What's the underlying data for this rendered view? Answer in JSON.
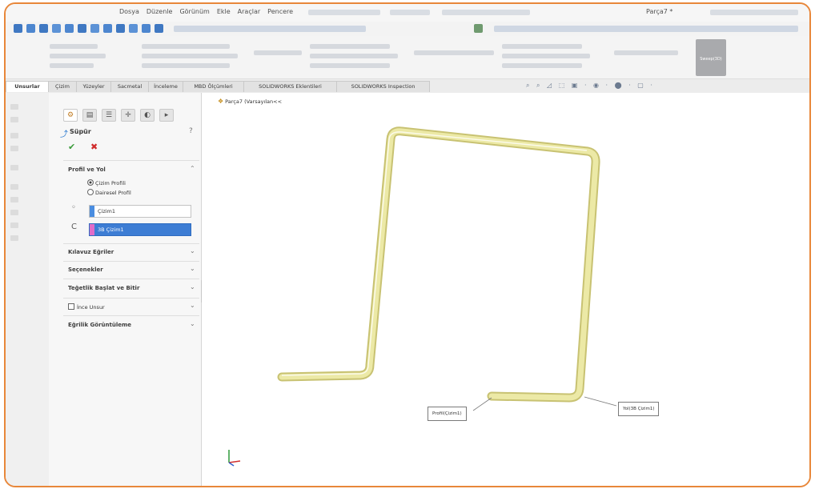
{
  "menubar": {
    "items": [
      "Dosya",
      "Düzenle",
      "Görünüm",
      "Ekle",
      "Araçlar",
      "Pencere"
    ],
    "document_title": "Parça7 *"
  },
  "tabs": [
    "Unsurlar",
    "Çizim",
    "Yüzeyler",
    "Sacmetal",
    "İnceleme",
    "MBD Ölçümleri",
    "SOLIDWORKS Eklentileri",
    "SOLIDWORKS Inspection"
  ],
  "ribbon": {
    "big_button_label": "Sweep(3D)"
  },
  "tree": {
    "part_name": "Parça7 (Varsayılan<<"
  },
  "property_manager": {
    "feature_title": "Süpür",
    "sections": {
      "profile_path": {
        "title": "Profil ve Yol",
        "options": [
          "Çizim Profili",
          "Dairesel Profil"
        ],
        "profile_value": "Çizim1",
        "path_value": "3B Çizim1"
      },
      "twist": "Kılavuz Eğriler",
      "options": "Seçenekler",
      "tangency": "Teğetlik Başlat ve Bitir",
      "thin": "İnce Unsur",
      "curvature": "Eğrilik Görüntüleme"
    }
  },
  "callouts": {
    "profile": "Profil(Çizim1)",
    "path": "Yol(3B Çizim1)"
  },
  "colors": {
    "accent_frame": "#e8873a",
    "pipe": "#ece9a6",
    "pipe_edge": "#c8c272",
    "selection_blue": "#3d7dd4",
    "profile_swatch": "#4a8de0",
    "path_swatch": "#e06cc9"
  }
}
